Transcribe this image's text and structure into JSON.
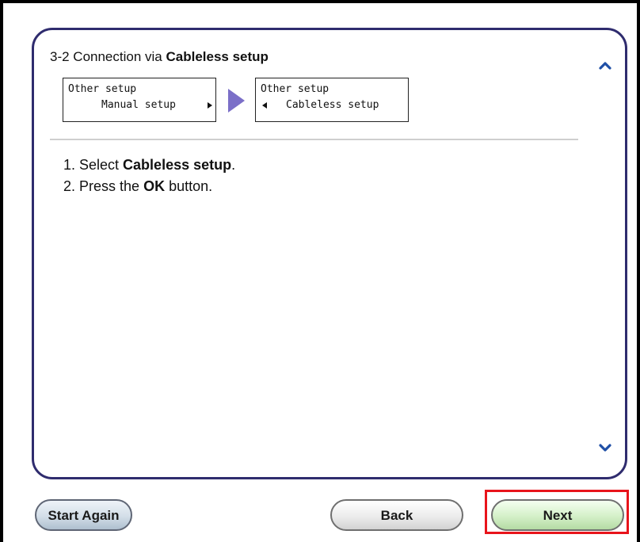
{
  "header": {
    "title_prefix": "3-2 Connection via ",
    "title_bold": "Cableless setup"
  },
  "menu_sequence": [
    {
      "line1": "Other setup",
      "line2": "Manual setup"
    },
    {
      "line1": "Other setup",
      "line2": "Cableless setup"
    }
  ],
  "steps": [
    {
      "prefix": "1. Select ",
      "bold": "Cableless setup",
      "suffix": "."
    },
    {
      "prefix": "2. Press the ",
      "bold": "OK",
      "suffix": " button."
    }
  ],
  "footer": {
    "start_again_label": "Start Again",
    "back_label": "Back",
    "next_label": "Next"
  },
  "icons": {
    "scroll_up": "chevron-up-icon",
    "scroll_down": "chevron-down-icon",
    "flow_arrow": "triangle-right-icon"
  },
  "colors": {
    "panel_border": "#2f2c6e",
    "chevron": "#1f4fa6",
    "flow_arrow": "#7b6fc8",
    "highlight": "#e8141b"
  }
}
